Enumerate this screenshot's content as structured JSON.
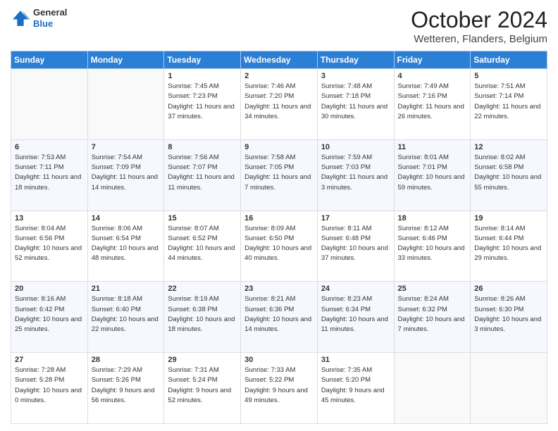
{
  "header": {
    "logo_line1": "General",
    "logo_line2": "Blue",
    "month": "October 2024",
    "location": "Wetteren, Flanders, Belgium"
  },
  "weekdays": [
    "Sunday",
    "Monday",
    "Tuesday",
    "Wednesday",
    "Thursday",
    "Friday",
    "Saturday"
  ],
  "weeks": [
    [
      {
        "day": "",
        "sunrise": "",
        "sunset": "",
        "daylight": ""
      },
      {
        "day": "",
        "sunrise": "",
        "sunset": "",
        "daylight": ""
      },
      {
        "day": "1",
        "sunrise": "Sunrise: 7:45 AM",
        "sunset": "Sunset: 7:23 PM",
        "daylight": "Daylight: 11 hours and 37 minutes."
      },
      {
        "day": "2",
        "sunrise": "Sunrise: 7:46 AM",
        "sunset": "Sunset: 7:20 PM",
        "daylight": "Daylight: 11 hours and 34 minutes."
      },
      {
        "day": "3",
        "sunrise": "Sunrise: 7:48 AM",
        "sunset": "Sunset: 7:18 PM",
        "daylight": "Daylight: 11 hours and 30 minutes."
      },
      {
        "day": "4",
        "sunrise": "Sunrise: 7:49 AM",
        "sunset": "Sunset: 7:16 PM",
        "daylight": "Daylight: 11 hours and 26 minutes."
      },
      {
        "day": "5",
        "sunrise": "Sunrise: 7:51 AM",
        "sunset": "Sunset: 7:14 PM",
        "daylight": "Daylight: 11 hours and 22 minutes."
      }
    ],
    [
      {
        "day": "6",
        "sunrise": "Sunrise: 7:53 AM",
        "sunset": "Sunset: 7:11 PM",
        "daylight": "Daylight: 11 hours and 18 minutes."
      },
      {
        "day": "7",
        "sunrise": "Sunrise: 7:54 AM",
        "sunset": "Sunset: 7:09 PM",
        "daylight": "Daylight: 11 hours and 14 minutes."
      },
      {
        "day": "8",
        "sunrise": "Sunrise: 7:56 AM",
        "sunset": "Sunset: 7:07 PM",
        "daylight": "Daylight: 11 hours and 11 minutes."
      },
      {
        "day": "9",
        "sunrise": "Sunrise: 7:58 AM",
        "sunset": "Sunset: 7:05 PM",
        "daylight": "Daylight: 11 hours and 7 minutes."
      },
      {
        "day": "10",
        "sunrise": "Sunrise: 7:59 AM",
        "sunset": "Sunset: 7:03 PM",
        "daylight": "Daylight: 11 hours and 3 minutes."
      },
      {
        "day": "11",
        "sunrise": "Sunrise: 8:01 AM",
        "sunset": "Sunset: 7:01 PM",
        "daylight": "Daylight: 10 hours and 59 minutes."
      },
      {
        "day": "12",
        "sunrise": "Sunrise: 8:02 AM",
        "sunset": "Sunset: 6:58 PM",
        "daylight": "Daylight: 10 hours and 55 minutes."
      }
    ],
    [
      {
        "day": "13",
        "sunrise": "Sunrise: 8:04 AM",
        "sunset": "Sunset: 6:56 PM",
        "daylight": "Daylight: 10 hours and 52 minutes."
      },
      {
        "day": "14",
        "sunrise": "Sunrise: 8:06 AM",
        "sunset": "Sunset: 6:54 PM",
        "daylight": "Daylight: 10 hours and 48 minutes."
      },
      {
        "day": "15",
        "sunrise": "Sunrise: 8:07 AM",
        "sunset": "Sunset: 6:52 PM",
        "daylight": "Daylight: 10 hours and 44 minutes."
      },
      {
        "day": "16",
        "sunrise": "Sunrise: 8:09 AM",
        "sunset": "Sunset: 6:50 PM",
        "daylight": "Daylight: 10 hours and 40 minutes."
      },
      {
        "day": "17",
        "sunrise": "Sunrise: 8:11 AM",
        "sunset": "Sunset: 6:48 PM",
        "daylight": "Daylight: 10 hours and 37 minutes."
      },
      {
        "day": "18",
        "sunrise": "Sunrise: 8:12 AM",
        "sunset": "Sunset: 6:46 PM",
        "daylight": "Daylight: 10 hours and 33 minutes."
      },
      {
        "day": "19",
        "sunrise": "Sunrise: 8:14 AM",
        "sunset": "Sunset: 6:44 PM",
        "daylight": "Daylight: 10 hours and 29 minutes."
      }
    ],
    [
      {
        "day": "20",
        "sunrise": "Sunrise: 8:16 AM",
        "sunset": "Sunset: 6:42 PM",
        "daylight": "Daylight: 10 hours and 25 minutes."
      },
      {
        "day": "21",
        "sunrise": "Sunrise: 8:18 AM",
        "sunset": "Sunset: 6:40 PM",
        "daylight": "Daylight: 10 hours and 22 minutes."
      },
      {
        "day": "22",
        "sunrise": "Sunrise: 8:19 AM",
        "sunset": "Sunset: 6:38 PM",
        "daylight": "Daylight: 10 hours and 18 minutes."
      },
      {
        "day": "23",
        "sunrise": "Sunrise: 8:21 AM",
        "sunset": "Sunset: 6:36 PM",
        "daylight": "Daylight: 10 hours and 14 minutes."
      },
      {
        "day": "24",
        "sunrise": "Sunrise: 8:23 AM",
        "sunset": "Sunset: 6:34 PM",
        "daylight": "Daylight: 10 hours and 11 minutes."
      },
      {
        "day": "25",
        "sunrise": "Sunrise: 8:24 AM",
        "sunset": "Sunset: 6:32 PM",
        "daylight": "Daylight: 10 hours and 7 minutes."
      },
      {
        "day": "26",
        "sunrise": "Sunrise: 8:26 AM",
        "sunset": "Sunset: 6:30 PM",
        "daylight": "Daylight: 10 hours and 3 minutes."
      }
    ],
    [
      {
        "day": "27",
        "sunrise": "Sunrise: 7:28 AM",
        "sunset": "Sunset: 5:28 PM",
        "daylight": "Daylight: 10 hours and 0 minutes."
      },
      {
        "day": "28",
        "sunrise": "Sunrise: 7:29 AM",
        "sunset": "Sunset: 5:26 PM",
        "daylight": "Daylight: 9 hours and 56 minutes."
      },
      {
        "day": "29",
        "sunrise": "Sunrise: 7:31 AM",
        "sunset": "Sunset: 5:24 PM",
        "daylight": "Daylight: 9 hours and 52 minutes."
      },
      {
        "day": "30",
        "sunrise": "Sunrise: 7:33 AM",
        "sunset": "Sunset: 5:22 PM",
        "daylight": "Daylight: 9 hours and 49 minutes."
      },
      {
        "day": "31",
        "sunrise": "Sunrise: 7:35 AM",
        "sunset": "Sunset: 5:20 PM",
        "daylight": "Daylight: 9 hours and 45 minutes."
      },
      {
        "day": "",
        "sunrise": "",
        "sunset": "",
        "daylight": ""
      },
      {
        "day": "",
        "sunrise": "",
        "sunset": "",
        "daylight": ""
      }
    ]
  ]
}
